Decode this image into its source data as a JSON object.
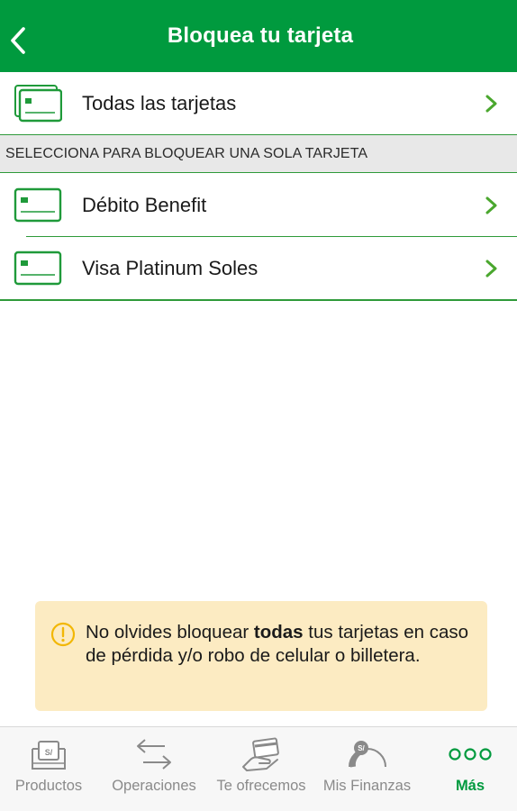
{
  "header": {
    "title": "Bloquea tu tarjeta"
  },
  "all_cards": {
    "label": "Todas las tarjetas"
  },
  "section": {
    "label": "SELECCIONA PARA BLOQUEAR UNA SOLA TARJETA"
  },
  "cards": [
    {
      "label": "Débito Benefit"
    },
    {
      "label": "Visa Platinum Soles"
    }
  ],
  "notice": {
    "text_before": "No olvides bloquear ",
    "text_bold": "todas",
    "text_after": " tus tarjetas en caso de pérdida y/o robo de celular o billetera."
  },
  "tabbar": {
    "tabs": [
      {
        "label": "Productos",
        "icon": "wallet-soles-icon"
      },
      {
        "label": "Operaciones",
        "icon": "transfer-arrows-icon"
      },
      {
        "label": "Te ofrecemos",
        "icon": "hand-card-icon"
      },
      {
        "label": "Mis Finanzas",
        "icon": "finance-gauge-icon"
      },
      {
        "label": "Más",
        "icon": "more-dots-icon"
      }
    ],
    "active": "Más"
  },
  "colors": {
    "brand_green": "#009a3e",
    "divider_green": "#2f9a3a",
    "notice_bg": "#fcebc2",
    "warning": "#f2b705"
  }
}
